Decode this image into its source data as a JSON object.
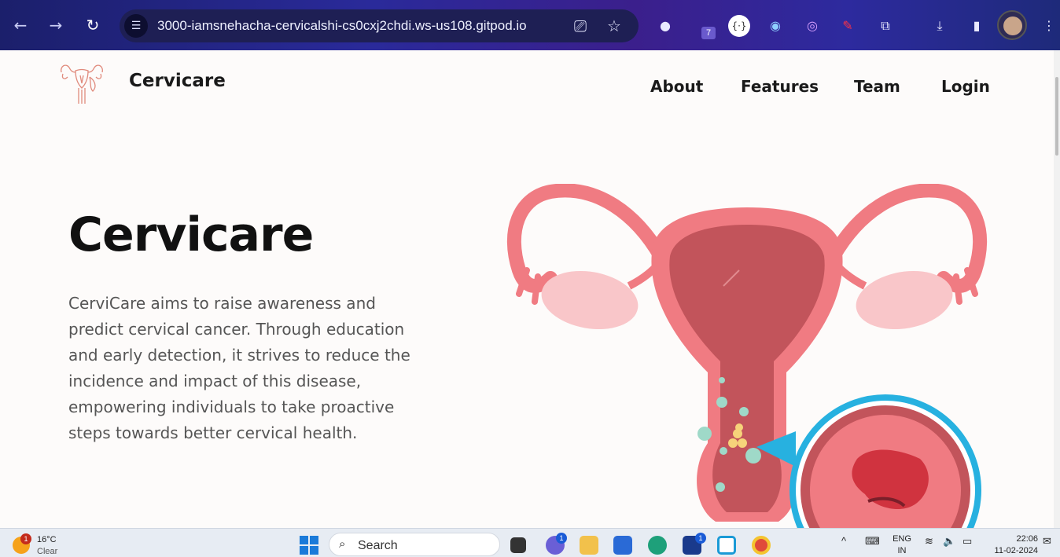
{
  "browser": {
    "url": "3000-iamsnehacha-cervicalshi-cs0cxj2chdi.ws-us108.gitpod.io",
    "extension_badge": "7"
  },
  "site": {
    "brand": "Cervicare",
    "nav": [
      "About",
      "Features",
      "Team",
      "Login"
    ]
  },
  "hero": {
    "title": "Cervicare",
    "text": "CerviCare aims to raise awareness and predict cervical cancer. Through education and early detection, it strives to reduce the incidence and impact of this disease, empowering individuals to take proactive steps towards better cervical health."
  },
  "taskbar": {
    "weather_temp": "16°C",
    "weather_condition": "Clear",
    "weather_badge": "1",
    "search_placeholder": "Search",
    "chat_badge": "1",
    "launcher_badge": "1",
    "language_top": "ENG",
    "language_bottom": "IN",
    "time": "22:06",
    "date": "11-02-2024"
  },
  "colors": {
    "accent_pink": "#f07b82",
    "dark_rose": "#c2545b",
    "cyan_ring": "#27b1e0"
  }
}
